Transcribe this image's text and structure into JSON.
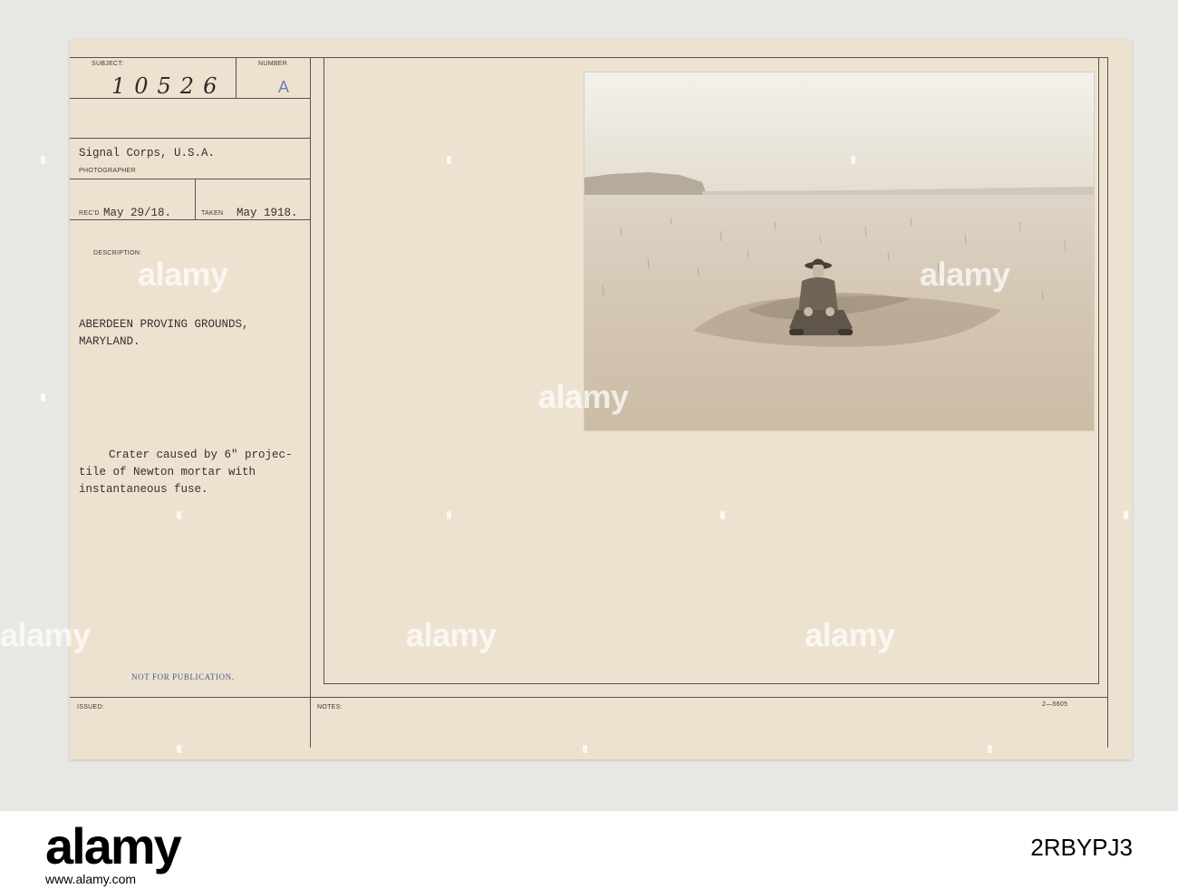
{
  "card": {
    "subject_label": "SUBJECT:",
    "number_label": "NUMBER",
    "subject_number": "10526",
    "subject_letter": "A",
    "photographer_value": "Signal Corps, U.S.A.",
    "photographer_label": "PHOTOGRAPHER",
    "recd_label": "REC'D",
    "recd_value": "May 29/18.",
    "taken_label": "TAKEN",
    "taken_value": "May 1918.",
    "description_label": "DESCRIPTION:",
    "location_line1": "ABERDEEN PROVING GROUNDS,",
    "location_line2": "MARYLAND.",
    "caption_line1": "Crater caused by 6\" projec-",
    "caption_line2": "tile of Newton mortar with",
    "caption_line3": "instantaneous fuse.",
    "not_for_publication": "NOT FOR PUBLICATION.",
    "issued_label": "ISSUED:",
    "notes_label": "NOTES:",
    "form_number": "2—5605"
  },
  "watermark": {
    "text": "alamy"
  },
  "footer": {
    "logo": "alamy",
    "image_id": "2RBYPJ3",
    "url": "www.alamy.com"
  }
}
